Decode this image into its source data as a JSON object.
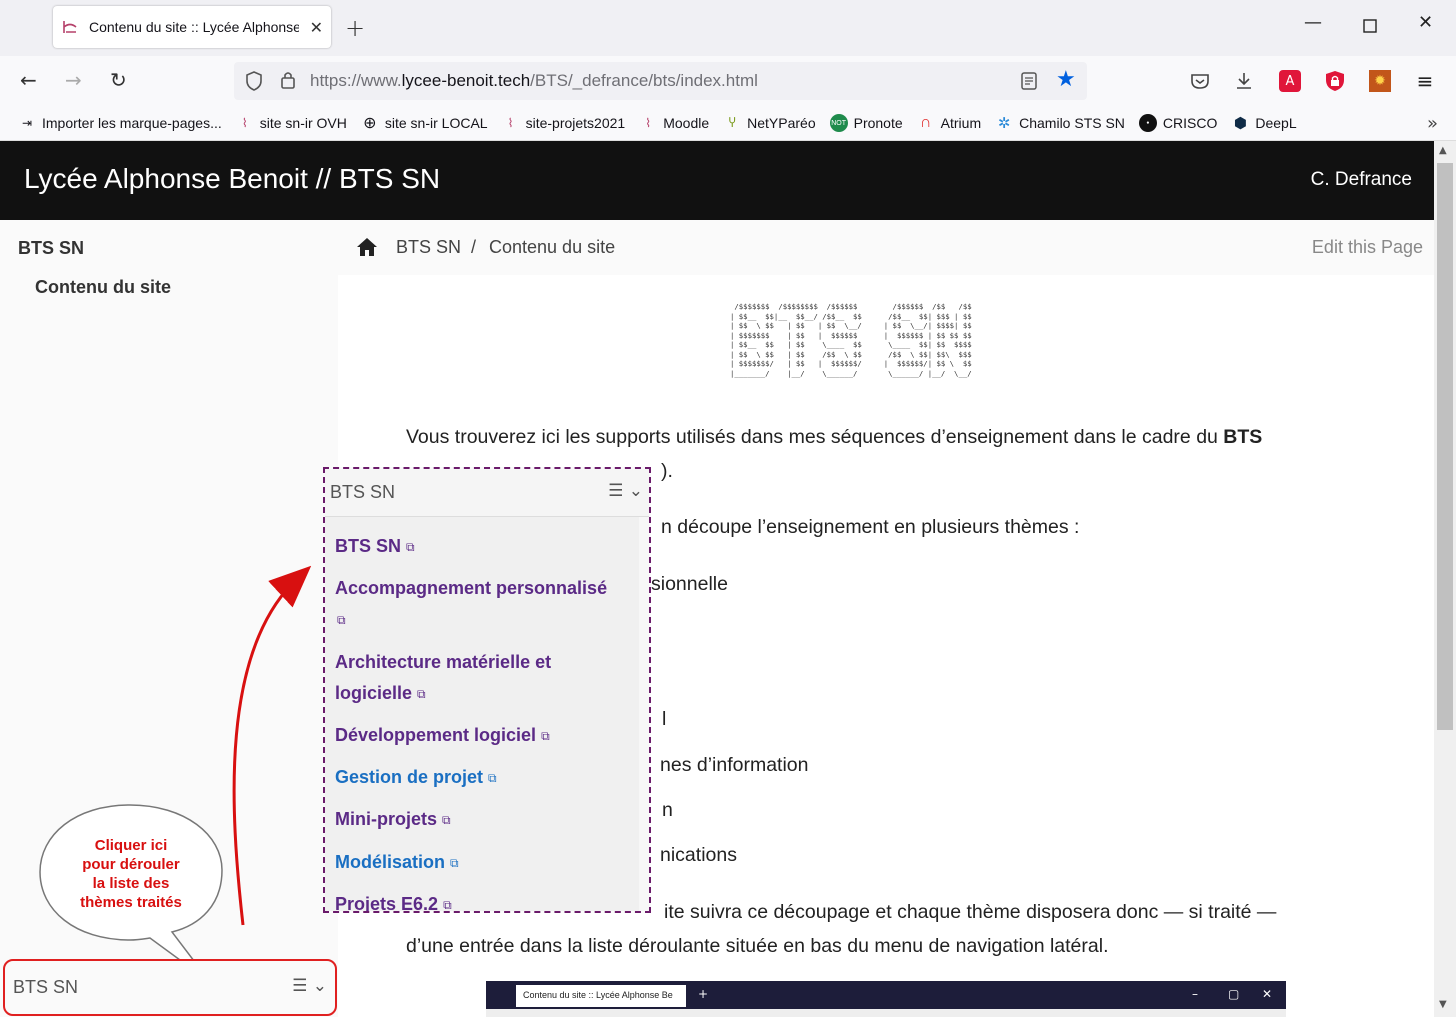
{
  "browser": {
    "tab_title": "Contenu du site :: Lycée Alphonse Benoit",
    "url_prefix": "https://www.",
    "url_domain": "lycee-benoit.tech",
    "url_path": "/BTS/_defrance/bts/index.html",
    "bookmarks": [
      {
        "label": "Importer les marque-pages...",
        "icon": "import-icon"
      },
      {
        "label": "site sn-ir OVH",
        "icon": "site-favicon"
      },
      {
        "label": "site sn-ir LOCAL",
        "icon": "globe-icon"
      },
      {
        "label": "site-projets2021",
        "icon": "site-favicon"
      },
      {
        "label": "Moodle",
        "icon": "site-favicon"
      },
      {
        "label": "NetYParéo",
        "icon": "netypareo-icon"
      },
      {
        "label": "Pronote",
        "icon": "pronote-icon"
      },
      {
        "label": "Atrium",
        "icon": "atrium-icon"
      },
      {
        "label": "Chamilo STS SN",
        "icon": "chamilo-icon"
      },
      {
        "label": "CRISCO",
        "icon": "crisco-icon"
      },
      {
        "label": "DeepL",
        "icon": "deepl-icon"
      }
    ]
  },
  "header": {
    "site_title": "Lycée Alphonse Benoit // BTS SN",
    "author": "C. Defrance"
  },
  "sidebar": {
    "title": "BTS SN",
    "current_item": "Contenu du site"
  },
  "breadcrumb": {
    "root": "BTS SN",
    "separator": "/",
    "current": "Contenu du site",
    "edit_label": "Edit this Page"
  },
  "ascii_art": " /$$$$$$$  /$$$$$$$$  /$$$$$$        /$$$$$$  /$$   /$$\n| $$__  $$|__  $$__/ /$$__  $$      /$$__  $$| $$$ | $$\n| $$  \\ $$   | $$   | $$  \\__/     | $$  \\__/| $$$$| $$\n| $$$$$$$    | $$   |  $$$$$$      |  $$$$$$ | $$ $$ $$\n| $$__  $$   | $$    \\____  $$      \\____  $$| $$  $$$$\n| $$  \\ $$   | $$    /$$  \\ $$      /$$  \\ $$| $$\\  $$$\n| $$$$$$$/   | $$   |  $$$$$$/     |  $$$$$$/| $$ \\  $$\n|_______/    |__/    \\______/       \\______/ |__/  \\__/",
  "content": {
    "line1_pre": "Vous trouverez ici les supports utilisés dans mes séquences d’enseignement dans le cadre du ",
    "line1_bold": "BTS",
    "line2_tail": ").",
    "line3_tail": "n découpe l’enseignement en plusieurs thèmes :",
    "line4_tail": "sionnelle",
    "line5_tail": "l",
    "line6_tail": "nes d’information",
    "line7_tail": "n",
    "line8_tail": "nications",
    "line9_tail": "ite suivra ce découpage et chaque thème disposera donc — si traité —",
    "line10": "d’une entrée dans la liste déroulante située en bas du menu de navigation latéral."
  },
  "embedded_screenshot": {
    "tab_title": "Contenu du site :: Lycée Alphonse Be"
  },
  "dropdown_popup": {
    "title": "BTS SN",
    "items": [
      {
        "label": "BTS SN",
        "color": "#5b2a86"
      },
      {
        "label": "Accompagnement personnalisé",
        "color": "#5b2a86"
      },
      {
        "label": "Architecture matérielle et",
        "label2": "logicielle",
        "color": "#5b2a86"
      },
      {
        "label": "Développement logiciel",
        "color": "#5b2a86"
      },
      {
        "label": "Gestion de projet",
        "color": "#1a6fc2"
      },
      {
        "label": "Mini-projets",
        "color": "#5b2a86"
      },
      {
        "label": "Modélisation",
        "color": "#1a6fc2"
      },
      {
        "label": "Projets E6.2",
        "color": "#5b2a86"
      }
    ]
  },
  "bottom_select": {
    "label": "BTS SN"
  },
  "callout": {
    "text_lines": [
      "Cliquer ici",
      "pour dérouler",
      "la liste des",
      "thèmes traités"
    ]
  },
  "colors": {
    "header_bg": "#111111",
    "link_visited": "#5b2a86",
    "link_blue": "#1a6fc2",
    "annotation_red": "#d81010",
    "bookmark_star": "#0060df"
  }
}
